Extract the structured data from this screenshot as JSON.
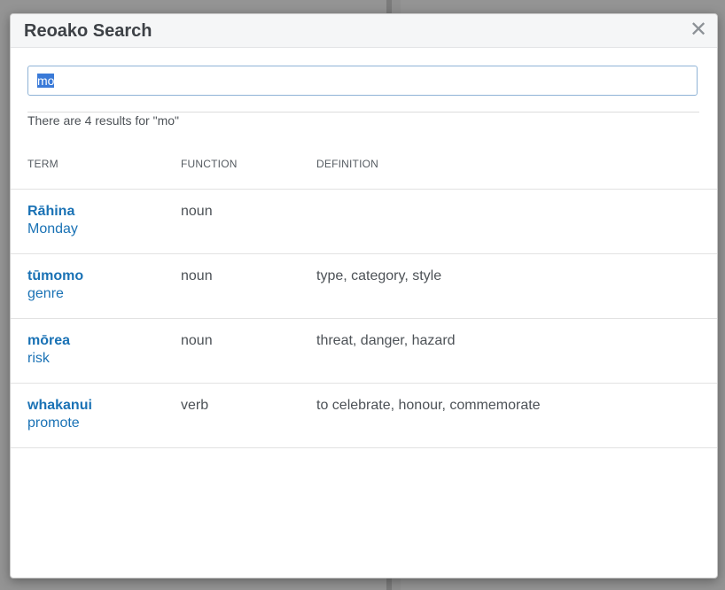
{
  "modal": {
    "title": "Reoako Search",
    "close_glyph": "✕"
  },
  "search": {
    "value": "mo"
  },
  "summary": "There are 4 results for \"mo\"",
  "table": {
    "headers": [
      "TERM",
      "FUNCTION",
      "DEFINITION"
    ],
    "rows": [
      {
        "term": "Rāhina",
        "translation": "Monday",
        "function": "noun",
        "definition": ""
      },
      {
        "term": "tūmomo",
        "translation": "genre",
        "function": "noun",
        "definition": "type, category, style"
      },
      {
        "term": "mōrea",
        "translation": "risk",
        "function": "noun",
        "definition": "threat, danger, hazard"
      },
      {
        "term": "whakanui",
        "translation": "promote",
        "function": "verb",
        "definition": "to celebrate, honour, commemorate"
      }
    ]
  },
  "icons": {
    "close": "close-icon"
  },
  "colors": {
    "accent": "#1a72b5",
    "input_border": "#8fb3d6"
  }
}
